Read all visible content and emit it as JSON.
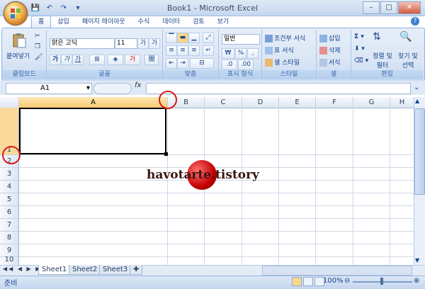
{
  "window": {
    "title": "Book1 - Microsoft Excel"
  },
  "qat": {
    "save": "💾",
    "undo": "↶",
    "redo": "↷",
    "more": "▾"
  },
  "tabs": [
    "홈",
    "삽입",
    "페이지 레이아웃",
    "수식",
    "데이터",
    "검토",
    "보기"
  ],
  "ribbon": {
    "clipboard": {
      "label": "클립보드",
      "paste": "붙여넣기"
    },
    "font": {
      "label": "글꼴",
      "name": "맑은 고딕",
      "size": "11"
    },
    "alignment": {
      "label": "맞춤"
    },
    "number": {
      "label": "표시 형식",
      "format": "일반"
    },
    "styles": {
      "label": "스타일",
      "cond": "조건부 서식",
      "table": "표 서식",
      "cell": "셀 스타일"
    },
    "cells": {
      "label": "셀",
      "insert": "삽입",
      "delete": "삭제",
      "format": "서식"
    },
    "editing": {
      "label": "편집",
      "sort": "정렬 및 필터",
      "find": "찾기 및 선택"
    }
  },
  "formula": {
    "namebox": "A1",
    "fx": "fx"
  },
  "columns": [
    "A",
    "B",
    "C",
    "D",
    "E",
    "F",
    "G",
    "H"
  ],
  "rows": [
    "1",
    "2",
    "3",
    "4",
    "5",
    "6",
    "7",
    "8",
    "9",
    "10"
  ],
  "sheets": [
    "Sheet1",
    "Sheet2",
    "Sheet3"
  ],
  "status": {
    "ready": "준비",
    "zoom": "100%"
  },
  "watermark": "havotarte.tistory"
}
